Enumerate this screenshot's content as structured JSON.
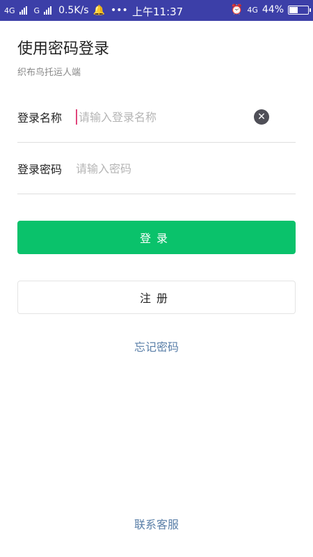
{
  "status_bar": {
    "net1": "4G",
    "net2": "G",
    "speed": "0.5K/s",
    "dots": "•••",
    "time": "上午11:37",
    "net3": "4G",
    "battery_pct": "44%",
    "battery_level": 0.44
  },
  "page": {
    "title": "使用密码登录",
    "subtitle": "织布鸟托运人端"
  },
  "form": {
    "username_label": "登录名称",
    "username_placeholder": "请输入登录名称",
    "password_label": "登录密码",
    "password_placeholder": "请输入密码"
  },
  "actions": {
    "login_label": "登录",
    "register_label": "注册",
    "forgot_label": "忘记密码",
    "contact_label": "联系客服"
  }
}
